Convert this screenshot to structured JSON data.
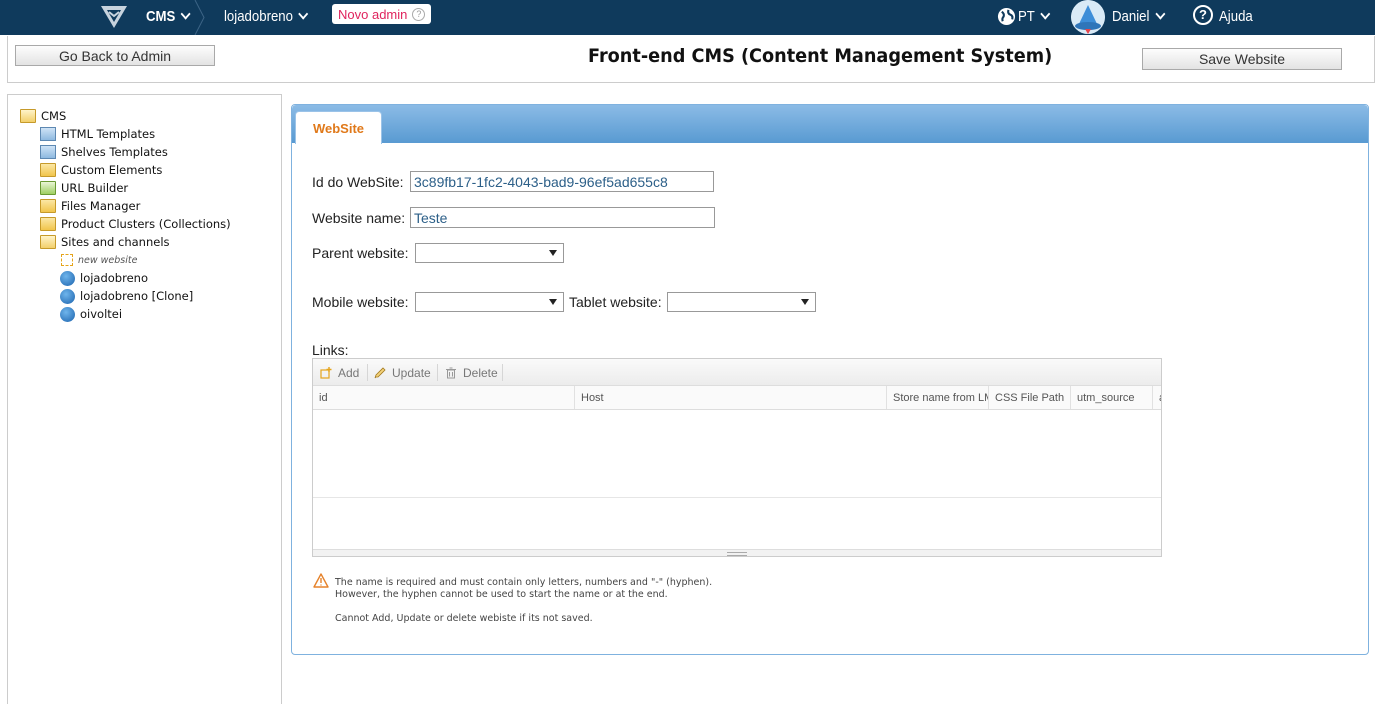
{
  "topbar": {
    "module": "CMS",
    "store": "lojadobreno",
    "badge": "Novo admin",
    "badge_help": "?",
    "language": "PT",
    "user": "Daniel",
    "help": "Ajuda"
  },
  "header": {
    "back_button": "Go Back to Admin",
    "title": "Front-end CMS (Content Management System)",
    "save_button": "Save Website"
  },
  "sidebar": {
    "root": "CMS",
    "items": [
      {
        "label": "HTML Templates",
        "icon": "html-templates-icon"
      },
      {
        "label": "Shelves Templates",
        "icon": "shelves-templates-icon"
      },
      {
        "label": "Custom Elements",
        "icon": "custom-elements-icon"
      },
      {
        "label": "URL Builder",
        "icon": "url-builder-icon"
      },
      {
        "label": "Files Manager",
        "icon": "folder-icon"
      },
      {
        "label": "Product Clusters (Collections)",
        "icon": "folder-icon"
      },
      {
        "label": "Sites and channels",
        "icon": "folder-open-icon"
      }
    ],
    "sites": [
      {
        "label": "new website",
        "icon": "new-website-icon"
      },
      {
        "label": "lojadobreno",
        "icon": "site-globe-icon"
      },
      {
        "label": "lojadobreno [Clone]",
        "icon": "site-globe-icon"
      },
      {
        "label": "oivoltei",
        "icon": "site-globe-icon"
      }
    ]
  },
  "panel": {
    "tab": "WebSite",
    "id_label": "Id do WebSite:",
    "id_value": "3c89fb17-1fc2-4043-bad9-96ef5ad655c8",
    "name_label": "Website name:",
    "name_value": "Teste",
    "parent_label": "Parent website:",
    "mobile_label": "Mobile website:",
    "tablet_label": "Tablet website:",
    "links_label": "Links:"
  },
  "grid": {
    "toolbar": {
      "add": "Add",
      "update": "Update",
      "delete": "Delete"
    },
    "columns": [
      "id",
      "Host",
      "Store name from LM",
      "CSS File Path",
      "utm_source",
      "a"
    ]
  },
  "notes": {
    "line1": "The name is required and must contain only letters, numbers and \"-\" (hyphen).",
    "line2": "However, the hyphen cannot be used to start the name or at the end.",
    "line3": "Cannot Add, Update or delete webiste if its not saved."
  },
  "colors": {
    "navbar": "#0f3a5c",
    "badge_text": "#e0245e",
    "tab_text": "#e0791a",
    "panel_border": "#7fb2df"
  }
}
